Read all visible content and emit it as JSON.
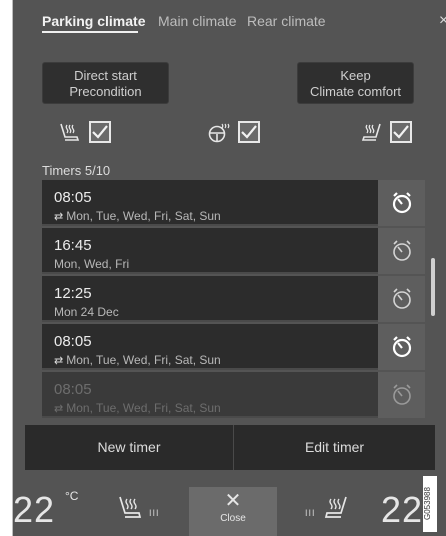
{
  "tabs": [
    {
      "label": "Parking climate",
      "active": true
    },
    {
      "label": "Main climate",
      "active": false
    },
    {
      "label": "Rear climate",
      "active": false
    }
  ],
  "close_tab_glyph": "×",
  "actions": {
    "direct_start": {
      "line1": "Direct start",
      "line2": "Precondition"
    },
    "keep_comfort": {
      "line1": "Keep",
      "line2": "Climate comfort"
    }
  },
  "options": [
    {
      "icon": "heated-seat-icon",
      "checked": true
    },
    {
      "icon": "heated-steering-wheel-icon",
      "checked": true
    },
    {
      "icon": "heated-rear-seat-icon",
      "checked": true
    }
  ],
  "timers_label": "Timers 5/10",
  "timers": [
    {
      "time": "08:05",
      "repeat": true,
      "days": "Mon, Tue, Wed, Fri, Sat, Sun",
      "active": true
    },
    {
      "time": "16:45",
      "repeat": false,
      "days": "Mon, Wed, Fri",
      "active": false
    },
    {
      "time": "12:25",
      "repeat": false,
      "days": "Mon 24 Dec",
      "active": false
    },
    {
      "time": "08:05",
      "repeat": true,
      "days": "Mon, Tue, Wed, Fri, Sat, Sun",
      "active": true
    },
    {
      "time": "08:05",
      "repeat": true,
      "days": "Mon, Tue, Wed, Fri, Sat, Sun",
      "active": false
    }
  ],
  "buttons": {
    "new_timer": "New timer",
    "edit_timer": "Edit timer"
  },
  "climate": {
    "left_temp": "22",
    "temp_unit": "°C",
    "right_temp": "22",
    "left_seat_level": "III",
    "right_seat_level": "III",
    "close_glyph": "✕",
    "close_label": "Close"
  },
  "image_code": "G053988",
  "colors": {
    "screen_bg": "#545454",
    "row_bg": "#2c2c2c",
    "timer_btn_bg": "#5e5e5e",
    "text": "#ececec"
  }
}
